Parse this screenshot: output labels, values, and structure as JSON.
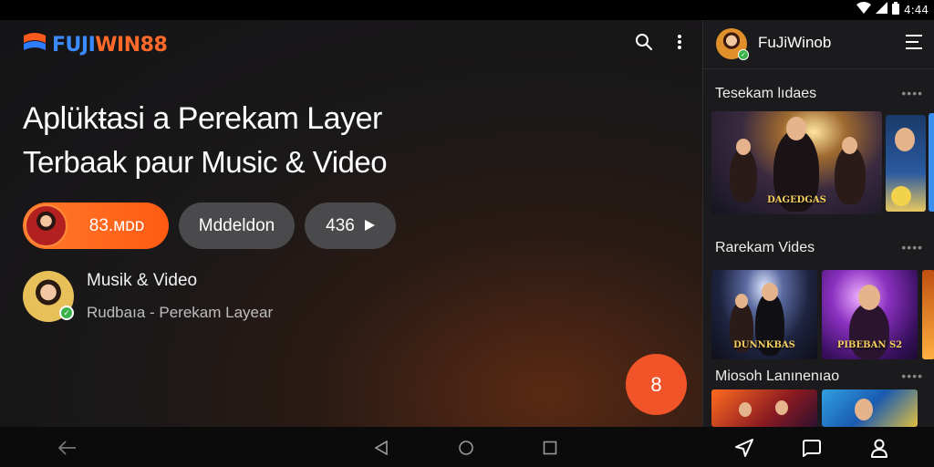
{
  "status_bar": {
    "time": "4:44",
    "icons": [
      "wifi-icon",
      "cellular-signal-icon",
      "battery-icon"
    ]
  },
  "header": {
    "logo_part_a": "FUJI",
    "logo_part_b": "WIN88",
    "icons": [
      "search-icon",
      "more-vert-icon"
    ]
  },
  "hero": {
    "title_line1": "Aplükŧasi a Perekam Layer",
    "title_line2": "Terbaak paur Music & Video"
  },
  "actions": {
    "primary_label": "83.ᴍᴅᴅ",
    "secondary_label": "Mddeldon",
    "play_label": "436"
  },
  "author": {
    "title": "Musik & Video",
    "subtitle": "Rudbaıa - Perekam Layear"
  },
  "fab": {
    "label": "8"
  },
  "side_panel": {
    "name": "FuJiWinob",
    "sections": [
      {
        "title": "Tesekam lıdaes",
        "more": "••••",
        "thumbnails": [
          {
            "caption": "DAGEDGAS"
          },
          {
            "caption": ""
          }
        ]
      },
      {
        "title": "Rarekam Vides",
        "more": "••••",
        "thumbnails": [
          {
            "caption": "DUNNKBAS"
          },
          {
            "caption": "PIBEBAN S2"
          }
        ]
      },
      {
        "title": "Miosoh Lanınenıao",
        "more": "••••"
      }
    ]
  },
  "nav_bar": {
    "left_icons": [
      "back-icon",
      "nav-back-triangle-icon",
      "home-icon",
      "recents-icon"
    ],
    "right_icons": [
      "send-icon",
      "chat-icon",
      "profile-icon"
    ]
  },
  "colors": {
    "accent_orange": "#ff6a1e",
    "fab": "#f2542a",
    "logo_blue": "#3b8bff",
    "logo_orange": "#ff6a2a"
  }
}
